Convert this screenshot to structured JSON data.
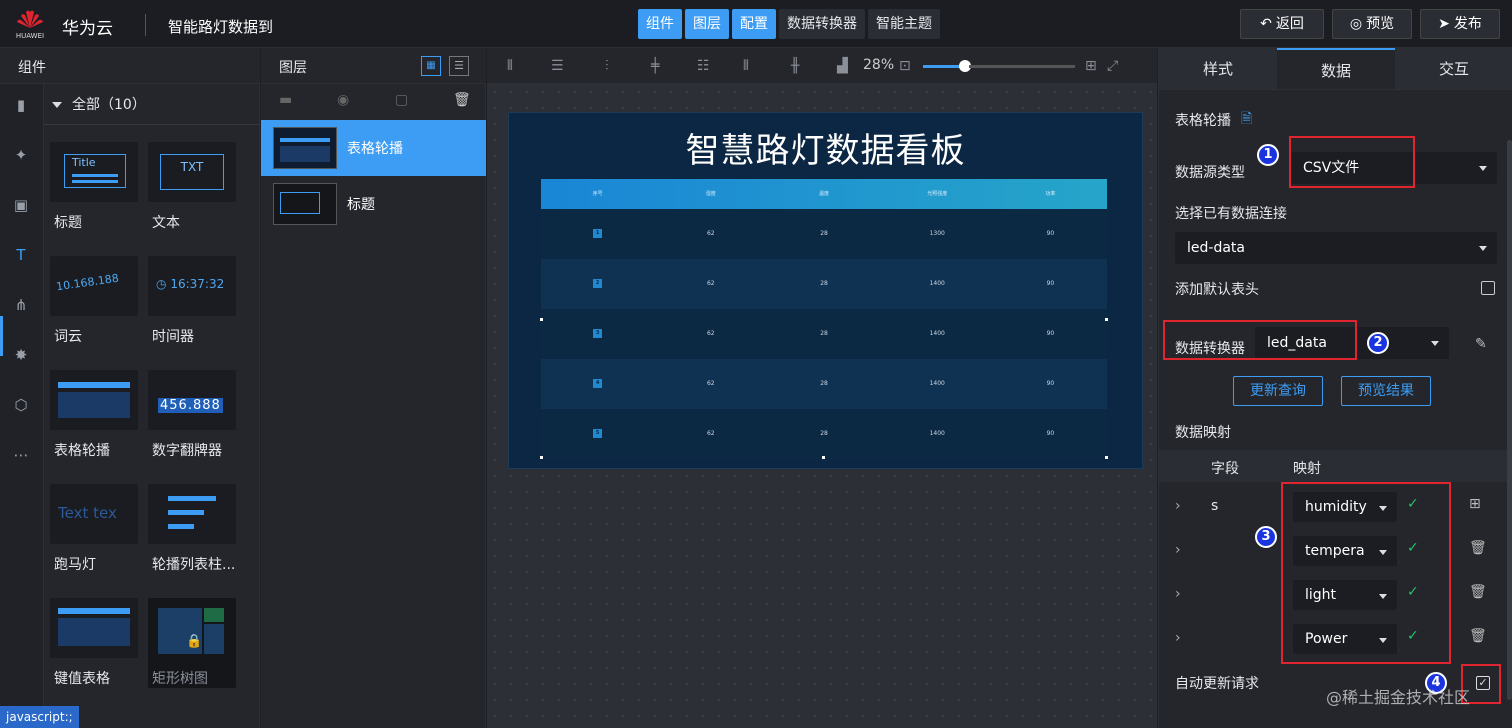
{
  "header": {
    "logo_text": "HUAWEI",
    "brand": "华为云",
    "project": "智能路灯数据到",
    "tabs": [
      {
        "label": "组件",
        "active": true
      },
      {
        "label": "图层",
        "active": true
      },
      {
        "label": "配置",
        "active": true
      },
      {
        "label": "数据转换器",
        "active": false
      },
      {
        "label": "智能主题",
        "active": false
      }
    ],
    "back": "返回",
    "preview": "预览",
    "publish": "发布"
  },
  "components": {
    "title": "组件",
    "category": "全部（10）",
    "items": [
      {
        "label": "标题",
        "thumb": "Title"
      },
      {
        "label": "文本",
        "thumb": "TXT"
      },
      {
        "label": "词云",
        "thumb": "10.168.188"
      },
      {
        "label": "时间器",
        "thumb": "16:37:32"
      },
      {
        "label": "表格轮播",
        "thumb": ""
      },
      {
        "label": "数字翻牌器",
        "thumb": "456.888"
      },
      {
        "label": "跑马灯",
        "thumb": "Text tex"
      },
      {
        "label": "轮播列表柱...",
        "thumb": ""
      },
      {
        "label": "键值表格",
        "thumb": ""
      },
      {
        "label": "矩形树图",
        "thumb": ""
      }
    ]
  },
  "layers": {
    "title": "图层",
    "items": [
      {
        "label": "表格轮播",
        "selected": true
      },
      {
        "label": "标题",
        "selected": false
      }
    ]
  },
  "canvas": {
    "zoom": "28%",
    "board_title": "智慧路灯数据看板",
    "table_headers": [
      "序号",
      "湿度",
      "温度",
      "光照强度",
      "功率"
    ],
    "rows": [
      [
        "1",
        "62",
        "28",
        "1300",
        "90"
      ],
      [
        "2",
        "62",
        "28",
        "1400",
        "90"
      ],
      [
        "3",
        "62",
        "28",
        "1400",
        "90"
      ],
      [
        "4",
        "62",
        "28",
        "1400",
        "90"
      ],
      [
        "5",
        "62",
        "28",
        "1400",
        "90"
      ]
    ]
  },
  "panel": {
    "tabs": [
      {
        "label": "样式",
        "active": false
      },
      {
        "label": "数据",
        "active": true
      },
      {
        "label": "交互",
        "active": false
      }
    ],
    "component_name": "表格轮播",
    "source_type_label": "数据源类型",
    "source_type_value": "CSV文件",
    "connection_label": "选择已有数据连接",
    "connection_value": "led-data",
    "default_header_label": "添加默认表头",
    "converter_label": "数据转换器",
    "converter_value": "led_data",
    "update_btn": "更新查询",
    "preview_btn": "预览结果",
    "mapping_label": "数据映射",
    "col_field": "字段",
    "col_map": "映射",
    "mappings": [
      {
        "field": "s",
        "map": "humidity"
      },
      {
        "field": "",
        "map": "tempera"
      },
      {
        "field": "",
        "map": "light"
      },
      {
        "field": "",
        "map": "Power"
      }
    ],
    "auto_update_label": "自动更新请求",
    "callouts": [
      "1",
      "2",
      "3",
      "4"
    ]
  },
  "status_text": "javascript:;",
  "watermark": "@稀土掘金技术社区",
  "colors": {
    "accent": "#3d9df5",
    "highlight": "#e0252f",
    "callout": "#1a35e0",
    "ok": "#2bbf6a"
  }
}
